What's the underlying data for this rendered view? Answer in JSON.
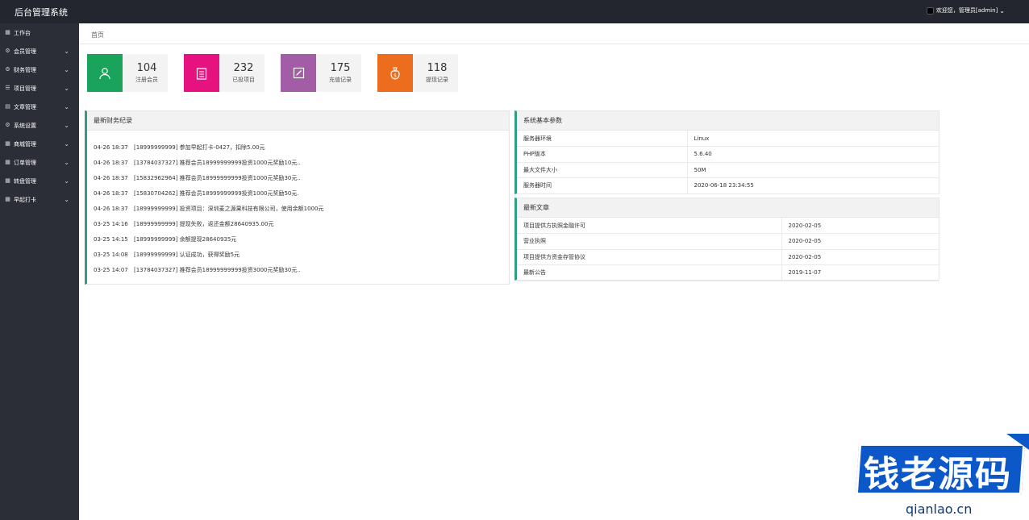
{
  "header": {
    "title": "后台管理系统",
    "user": "欢迎您，管理员[admin]"
  },
  "sidebar": {
    "items": [
      {
        "label": "工作台",
        "icon": "grid-icon",
        "arrow": false
      },
      {
        "label": "会员管理",
        "icon": "gear-icon",
        "arrow": true
      },
      {
        "label": "财务管理",
        "icon": "gear-icon",
        "arrow": true
      },
      {
        "label": "项目管理",
        "icon": "list-icon",
        "arrow": true
      },
      {
        "label": "文章管理",
        "icon": "document-icon",
        "arrow": true
      },
      {
        "label": "系统设置",
        "icon": "gear-icon",
        "arrow": true
      },
      {
        "label": "商城管理",
        "icon": "grid-icon",
        "arrow": true
      },
      {
        "label": "订单管理",
        "icon": "grid-icon",
        "arrow": true
      },
      {
        "label": "转盘管理",
        "icon": "grid-icon",
        "arrow": true
      },
      {
        "label": "早起打卡",
        "icon": "grid-icon",
        "arrow": true
      }
    ]
  },
  "breadcrumb": {
    "home": "首页"
  },
  "stats": [
    {
      "value": "104",
      "label": "注册会员",
      "color": "#1aa35a",
      "icon": "user-icon"
    },
    {
      "value": "232",
      "label": "已投项目",
      "color": "#e6127f",
      "icon": "clipboard-icon"
    },
    {
      "value": "175",
      "label": "充值记录",
      "color": "#a35ca6",
      "icon": "edit-icon"
    },
    {
      "value": "118",
      "label": "提现记录",
      "color": "#ec6d1e",
      "icon": "money-bag-icon"
    }
  ],
  "finance": {
    "title": "最新财务纪录",
    "rows": [
      {
        "time": "04-26 18:37",
        "text": "[18999999999] 参加早起打卡-0427，扣除5.00元"
      },
      {
        "time": "04-26 18:37",
        "text": "[13784037327] 推荐会员18999999999投资1000元奖励10元.."
      },
      {
        "time": "04-26 18:37",
        "text": "[15832962964] 推荐会员18999999999投资1000元奖励30元.."
      },
      {
        "time": "04-26 18:37",
        "text": "[15830704262] 推荐会员18999999999投资1000元奖励50元."
      },
      {
        "time": "04-26 18:37",
        "text": "[18999999999] 投资项目：深圳麦之源果科技有限公司，使用余额1000元"
      },
      {
        "time": "03-25 14:16",
        "text": "[18999999999] 提现失败，返还金额28640935.00元"
      },
      {
        "time": "03-25 14:15",
        "text": "[18999999999] 余额提现28640935元"
      },
      {
        "time": "03-25 14:08",
        "text": "[18999999999] 认证成功，获得奖励5元"
      },
      {
        "time": "03-25 14:07",
        "text": "[13784037327] 推荐会员18999999999投资3000元奖励30元.."
      }
    ]
  },
  "system": {
    "title": "系统基本参数",
    "rows": [
      {
        "k": "服务器环境",
        "v": "Linux"
      },
      {
        "k": "PHP版本",
        "v": "5.6.40"
      },
      {
        "k": "最大文件大小",
        "v": "50M"
      },
      {
        "k": "服务器时间",
        "v": "2020-06-18 23:34:55"
      }
    ]
  },
  "articles": {
    "title": "最新文章",
    "rows": [
      {
        "k": "项目提供方执照金融许可",
        "v": "2020-02-05"
      },
      {
        "k": "营业执照",
        "v": "2020-02-05"
      },
      {
        "k": "项目提供方资金存管协议",
        "v": "2020-02-05"
      },
      {
        "k": "最新公告",
        "v": "2019-11-07"
      }
    ]
  },
  "watermark": {
    "brand": "钱老源码",
    "url": "qianlao.cn"
  }
}
